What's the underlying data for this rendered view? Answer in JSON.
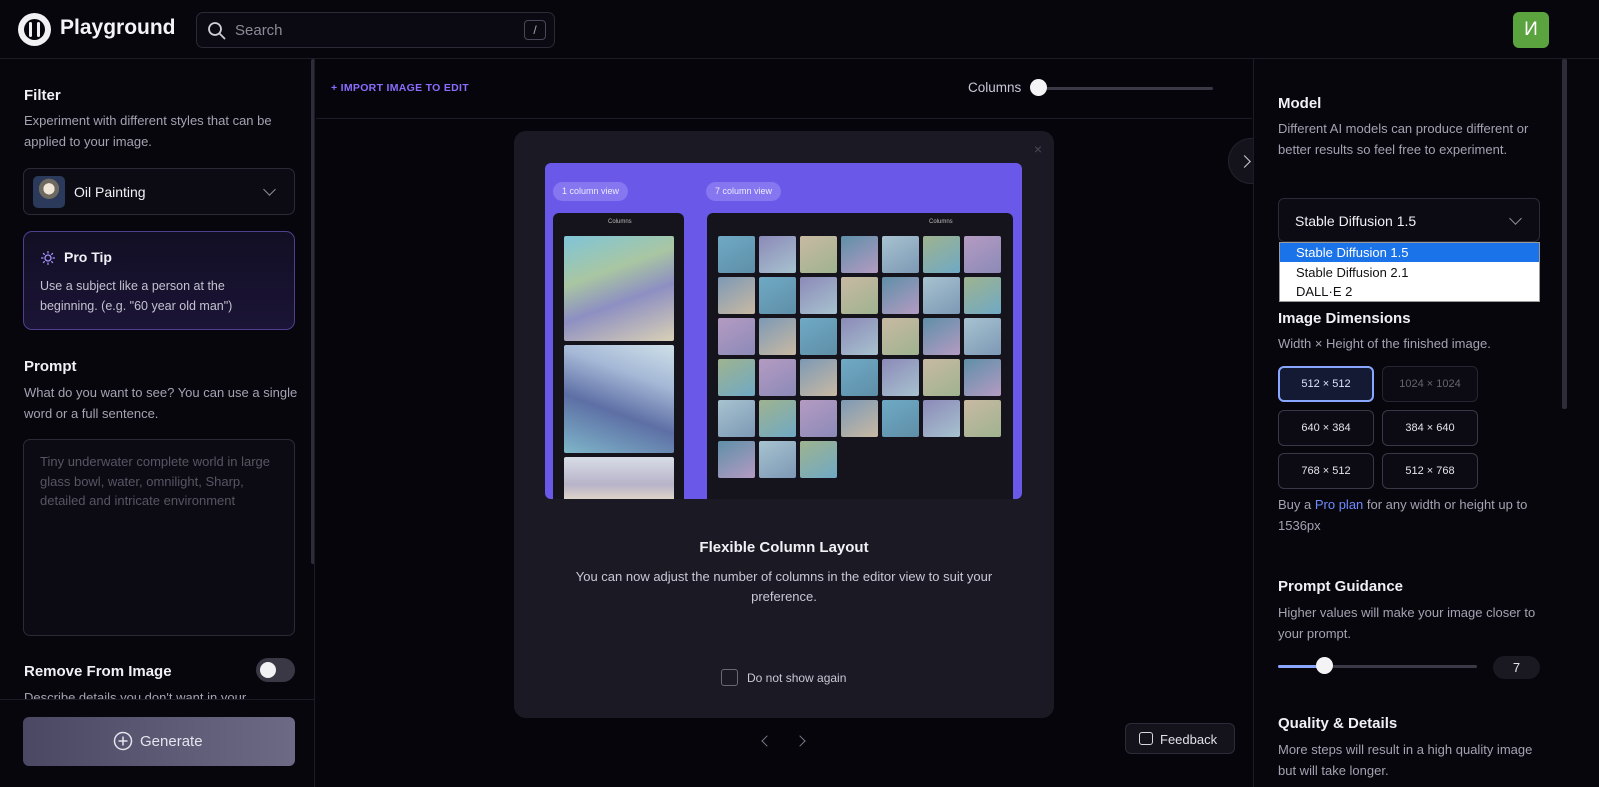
{
  "header": {
    "brand": "Playground",
    "search_placeholder": "Search",
    "search_shortcut": "/",
    "avatar_initial": "И"
  },
  "left_panel": {
    "filter_title": "Filter",
    "filter_desc": "Experiment with different styles that can be applied to your image.",
    "filter_value": "Oil Painting",
    "protip_title": "Pro Tip",
    "protip_text": "Use a subject like a person at the beginning. (e.g. \"60 year old man\")",
    "prompt_title": "Prompt",
    "prompt_desc": "What do you want to see? You can use a single word or a full sentence.",
    "prompt_placeholder": "Tiny underwater complete world in large glass bowl, water, omnilight, Sharp, detailed and intricate environment",
    "remove_title": "Remove From Image",
    "remove_desc": "Describe details you don't want in your",
    "remove_enabled": false,
    "generate_label": "Generate"
  },
  "center": {
    "import_label": "+ IMPORT IMAGE TO EDIT",
    "columns_label": "Columns",
    "columns_value": 1,
    "modal": {
      "close_label": "×",
      "tag_one": "1 column view",
      "tag_seven": "7 column view",
      "phone_status_one": "Columns",
      "phone_status_seven": "Columns",
      "title": "Flexible Column Layout",
      "text": "You can now adjust the number of columns in the editor view to suit your preference.",
      "checkbox_label": "Do not show again",
      "checkbox_checked": false
    },
    "feedback_label": "Feedback"
  },
  "right_panel": {
    "model_title": "Model",
    "model_desc": "Different AI models can produce different or better results so feel free to experiment.",
    "model_value": "Stable Diffusion 1.5",
    "model_options": [
      "Stable Diffusion 1.5",
      "Stable Diffusion 2.1",
      "DALL·E 2"
    ],
    "model_selected_index": 0,
    "dims_title": "Image Dimensions",
    "dims_desc": "Width × Height of the finished image.",
    "dims": [
      "512 × 512",
      "1024 × 1024",
      "640 × 384",
      "384 × 640",
      "768 × 512",
      "512 × 768"
    ],
    "dims_active": "512 × 512",
    "dims_disabled": "1024 × 1024",
    "upsell_prefix": "Buy a ",
    "upsell_link": "Pro plan",
    "upsell_suffix": " for any width or height up to 1536px",
    "guidance_title": "Prompt Guidance",
    "guidance_desc": "Higher values will make your image closer to your prompt.",
    "guidance_value": "7",
    "guidance_fraction": 0.24,
    "quality_title": "Quality & Details",
    "quality_desc": "More steps will result in a high quality image but will take longer."
  },
  "colors": {
    "accent": "#8b6cff",
    "link": "#6f8cff",
    "preview_bg": "#6a59e8",
    "avatar": "#5aa33e",
    "dropdown_selected": "#1a73e8"
  }
}
